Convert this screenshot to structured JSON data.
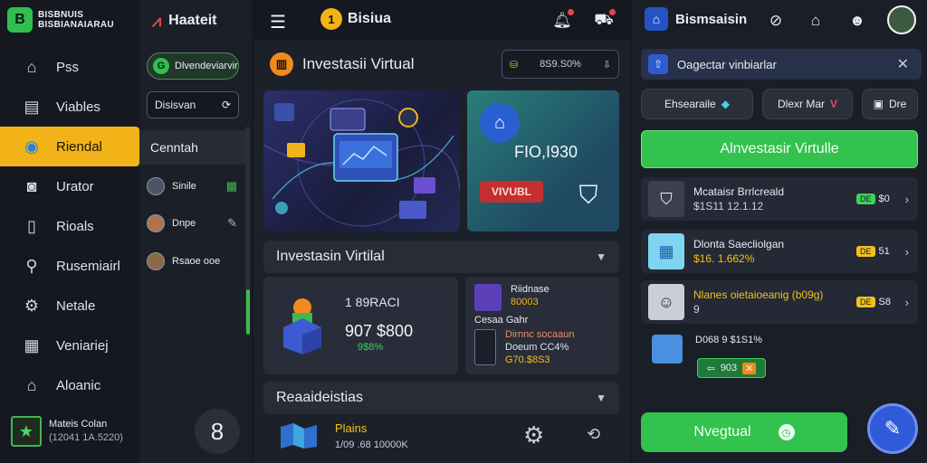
{
  "sidebar": {
    "brand_line1": "BISBNUIS",
    "brand_line2": "BISBIANAIARAU",
    "items": [
      {
        "label": "Pss",
        "icon": "home-icon"
      },
      {
        "label": "Viables",
        "icon": "clipboard-icon"
      },
      {
        "label": "Riendal",
        "icon": "coins-icon"
      },
      {
        "label": "Urator",
        "icon": "camera-icon"
      },
      {
        "label": "Rioals",
        "icon": "phone-icon"
      },
      {
        "label": "Rusemiairl",
        "icon": "wrench-icon"
      },
      {
        "label": "Netale",
        "icon": "gear-icon"
      },
      {
        "label": "Veniariej",
        "icon": "document-icon"
      },
      {
        "label": "Aloanic",
        "icon": "home-icon"
      }
    ],
    "active_index": 2,
    "profile": {
      "name": "Mateis Colan",
      "sub": "(12041 1A.5220)"
    }
  },
  "col2": {
    "title": "Haateit",
    "pill_label": "Dlvendeviarvir",
    "search_placeholder": "Disisvan",
    "contact_header": "Cenntah",
    "contacts": [
      {
        "name": "Sinile"
      },
      {
        "name": "Dnpe"
      },
      {
        "name": "Rsaoe ooe"
      }
    ],
    "badge_number": "8"
  },
  "topbar": {
    "brand": "Bisiua"
  },
  "main": {
    "title": "Investasii Virtual",
    "stat": "8S9.S0%",
    "hero_amount": "FIO,I930",
    "hero_tag": "VIVUBL",
    "section1_title": "Investasin Virtilal",
    "card_a": {
      "line1": "1 89RACI",
      "line2": "907 $800",
      "line3": "9$8%"
    },
    "card_b": {
      "row1_title": "Riidnase",
      "row1_value": "80003",
      "row2": "Cesaa Gahr",
      "row3_line1": "Dirnnc socaaun",
      "row3_line2": "Doeum CC4%",
      "row3_line3": "G70.$8S3"
    },
    "section2_title": "Reaaideistias",
    "list_item": {
      "name": "Plains",
      "sub": "1/09 .68 10000K"
    }
  },
  "right": {
    "title": "Bismsaisin",
    "banner": "Oagectar vinbiarlar",
    "chip1": "Ehsearaile",
    "chip2": "Dlexr Mar",
    "chip3": "Dre",
    "cta": "Alnvestasir Virtulle",
    "items": [
      {
        "title": "Mcataisr Brrlcreald",
        "sub": "$1S11 12.1.12",
        "val": "$0",
        "pill": "DE",
        "pill_color": "#3fd15a"
      },
      {
        "title": "Dlonta Saecliolgan",
        "sub": "$16. 1.662%",
        "val": "51",
        "pill": "DE",
        "pill_color": "#f2c21b"
      },
      {
        "title": "Nlanes oietaioeanig (b09g)",
        "sub": "9",
        "val": "S8",
        "pill": "DE",
        "pill_color": "#f2c21b"
      }
    ],
    "mini_line": "D068 9 $1S1%",
    "mini_badge": "903",
    "main_button": "Nvegtual"
  },
  "colors": {
    "accent": "#f2b318",
    "green": "#33c24e",
    "blue": "#2f5bd8"
  }
}
